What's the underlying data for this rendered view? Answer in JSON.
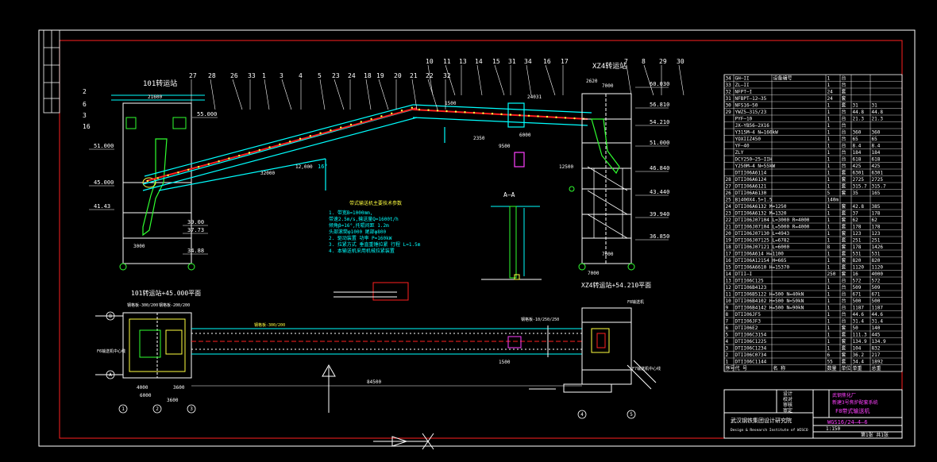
{
  "colors": {
    "bg": "#000000",
    "frame": "#ffffff",
    "border": "#ff2020",
    "cyan": "#00ffff",
    "white": "#ffffff",
    "green": "#30ff30",
    "yellow": "#ffff40",
    "red": "#ff2020",
    "magenta": "#ff40ff"
  },
  "views": {
    "elevation": {
      "left_title": "101转运站",
      "right_title": "XZ4转运站",
      "callouts_top": [
        "27",
        "28",
        "26",
        "33",
        "1",
        "3",
        "4",
        "5",
        "23",
        "24",
        "18",
        "19",
        "20",
        "21",
        "22",
        "32",
        "10",
        "11",
        "13",
        "14",
        "15",
        "31",
        "34",
        "16",
        "17",
        "7",
        "8",
        "29",
        "30"
      ],
      "callouts_left": [
        "2",
        "6",
        "3",
        "16"
      ],
      "dims": [
        "21600",
        "32000",
        "2350",
        "9500",
        "12,000",
        "2620",
        "7000",
        "3000",
        "7000",
        "7000",
        "24031",
        "1500",
        "12500",
        "6000"
      ],
      "left_elev": [
        "51.000",
        "45.000",
        "41.43",
        "39.00",
        "37.73",
        "34.88",
        "55.000"
      ],
      "right_elev": [
        "60.030",
        "56.810",
        "54.210",
        "51.000",
        "46.840",
        "43.440",
        "39.940",
        "36.850"
      ],
      "notes_title": "带式输送机主要技术参数",
      "notes": [
        "1. 带宽B=1000mm,",
        "   带速2.5m/s,输送量Q=1600t/h",
        "   倾角β=16°,托辊间距 1.2m",
        "   头部滚筒φ1000 尾部φ800",
        "2. 驱动装置 功率 P=160kW",
        "3. 拉紧方式 垂直重锤拉紧 行程 L=1.5m",
        "4. 本输送机采用机械拉紧装置"
      ],
      "section_label": "A—A",
      "angle": "16°"
    },
    "plan": {
      "left_title": "101转运站+45.000平面",
      "right_title": "XZ4转运站+54.210平面",
      "labels": [
        "钢格板-300/200",
        "钢格板-200/200",
        "F6输送机中心线",
        "钢格板-10/250/250",
        "F7输送机中心线",
        "F8输送机"
      ],
      "dims": [
        "6000",
        "4000",
        "3600",
        "3600",
        "84500",
        "1500"
      ],
      "axes": [
        "A",
        "B",
        "1",
        "2",
        "3",
        "4",
        "5"
      ]
    }
  },
  "bom": {
    "rows": [
      [
        "34",
        "GH—II",
        "设备编号",
        "1",
        "台",
        "",
        ""
      ],
      [
        "33",
        "ZL—II",
        "",
        "1",
        "台",
        "",
        ""
      ],
      [
        "32",
        "NFPT—I",
        "",
        "24",
        "套",
        "",
        ""
      ],
      [
        "31",
        "NFBPT—12—35",
        "",
        "24",
        "套",
        "",
        ""
      ],
      [
        "30",
        "NFS16—50",
        "",
        "1",
        "套",
        "31",
        "31"
      ],
      [
        "29",
        "YWZ5—315/23",
        "",
        "1",
        "台",
        "44.8",
        "44.8"
      ],
      [
        "",
        "PYF—10",
        "",
        "1",
        "台",
        "21.3",
        "21.3"
      ],
      [
        "",
        "JX—YB56—2X16",
        "",
        "1",
        "台",
        "",
        ""
      ],
      [
        "",
        "Y315M—4  N=160kW",
        "",
        "1",
        "台",
        "360",
        "360"
      ],
      [
        "",
        "YOXIIZ450",
        "",
        "1",
        "台",
        "65",
        "65"
      ],
      [
        "",
        "YF—40",
        "",
        "1",
        "台",
        "8.4",
        "8.4"
      ],
      [
        "",
        "ZLY",
        "",
        "1",
        "台",
        "184",
        "184"
      ],
      [
        "",
        "DCY250—25—IIH",
        "",
        "1",
        "台",
        "618",
        "618"
      ],
      [
        "",
        "Y250M—4  N=55kW",
        "",
        "1",
        "台",
        "425",
        "425"
      ],
      [
        "",
        "DTII06A6114",
        "",
        "1",
        "套",
        "6301",
        "6301"
      ],
      [
        "28",
        "DTII06A6124",
        "",
        "1",
        "套",
        "2725",
        "2725"
      ],
      [
        "27",
        "DTII06A6121",
        "",
        "1",
        "套",
        "315.7",
        "315.7"
      ],
      [
        "26",
        "DTII06A6130",
        "",
        "5",
        "套",
        "35",
        "165"
      ],
      [
        "25",
        "B1400X4.5+1.5",
        "",
        "140m",
        "",
        "",
        ""
      ],
      [
        "24",
        "DTII06A6132  M=1250",
        "",
        "1",
        "套",
        "42.8",
        "385"
      ],
      [
        "23",
        "DTII06A6132  M=1320",
        "",
        "1",
        "套",
        "37",
        "178"
      ],
      [
        "22",
        "DTII06J07104  L=3000 R=4000",
        "",
        "1",
        "套",
        "62",
        "62"
      ],
      [
        "21",
        "DTII06J07104  L=5000 R=4000",
        "",
        "1",
        "套",
        "178",
        "178"
      ],
      [
        "20",
        "DTII06J07130  L=4943",
        "",
        "1",
        "套",
        "123",
        "123"
      ],
      [
        "19",
        "DTII06J07125  L=6782",
        "",
        "1",
        "套",
        "251",
        "251"
      ],
      [
        "18",
        "DTII06J07121  L=6000",
        "",
        "8",
        "套",
        "178",
        "1426"
      ],
      [
        "17",
        "DTII06A614  H=1100",
        "",
        "1",
        "套",
        "531",
        "531"
      ],
      [
        "16",
        "DTII06A12154  H=665",
        "",
        "1",
        "套",
        "820",
        "820"
      ],
      [
        "15",
        "DTII06A6610  H=15370",
        "",
        "1",
        "套",
        "1120",
        "1120"
      ],
      [
        "14",
        "DTII—I",
        "",
        "250",
        "套",
        "16",
        "4000"
      ],
      [
        "13",
        "DTII06C125",
        "",
        "1",
        "台",
        "572",
        "572"
      ],
      [
        "12",
        "DTII06B4123",
        "",
        "1",
        "台",
        "509",
        "509"
      ],
      [
        "11",
        "DTII06B5122  H=500 N=40kN",
        "",
        "1",
        "台",
        "671",
        "671"
      ],
      [
        "10",
        "DTII06B4102  H=500 N=50kN",
        "",
        "1",
        "台",
        "500",
        "500"
      ],
      [
        "9",
        "DTII06B4142  H=500 N=90kN",
        "",
        "1",
        "台",
        "1187",
        "1187"
      ],
      [
        "8",
        "DTII06JF5",
        "",
        "1",
        "台",
        "44.6",
        "44.6"
      ],
      [
        "7",
        "DTII06JF3",
        "",
        "1",
        "台",
        "31.4",
        "31.4"
      ],
      [
        "6",
        "DTII06E2",
        "",
        "1",
        "套",
        "50",
        "140"
      ],
      [
        "5",
        "DTII06C3154",
        "",
        "1",
        "套",
        "111.3",
        "445"
      ],
      [
        "4",
        "DTII06C1225",
        "",
        "1",
        "套",
        "134.9",
        "134.9"
      ],
      [
        "3",
        "DTII06C1234",
        "",
        "1",
        "套",
        "104",
        "832"
      ],
      [
        "2",
        "DTII06C0734",
        "",
        "6",
        "套",
        "36.2",
        "217"
      ],
      [
        "1",
        "DTII06C1144",
        "",
        "55",
        "套",
        "34.4",
        "1892"
      ]
    ],
    "header": [
      "序号",
      "代 号",
      "名    称",
      "数量",
      "单位",
      "单重",
      "总重"
    ]
  },
  "title_block": {
    "company": "武汉钢铁集团设计研究院",
    "company_en": "Design & Research Institute of WISCO",
    "project": "武钢焦化厂",
    "drawing_title_1": "新建3号焦炉配套系统",
    "drawing_title_2": "F8带式输送机",
    "drawing_no": "WGS16/24—4—6",
    "scale": "1:150",
    "sheet": "第1张 共1张",
    "roles": [
      "设计",
      "校对",
      "审核",
      "审定"
    ]
  }
}
